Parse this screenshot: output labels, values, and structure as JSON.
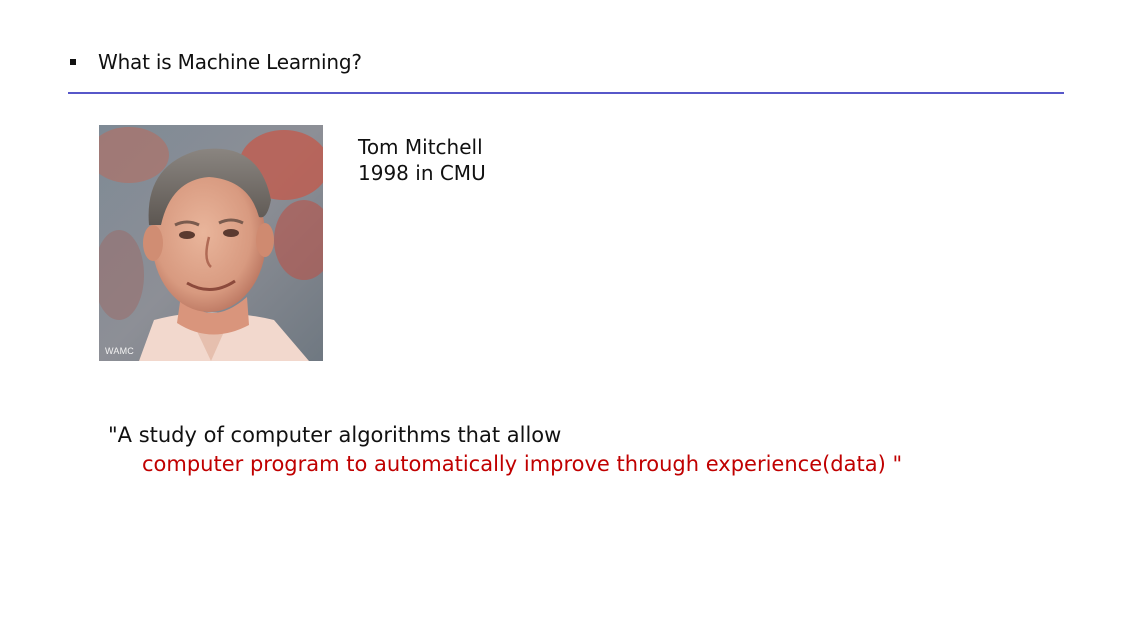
{
  "slide": {
    "title": "What is Machine Learning?",
    "accent_rule_color": "#5757c9",
    "quote_highlight_color": "#c00000"
  },
  "person": {
    "name": "Tom Mitchell",
    "detail": "1998 in CMU",
    "photo_watermark": "WAMC"
  },
  "quote": {
    "line1": "\"A study of computer algorithms that allow",
    "line2": "computer program to automatically improve through experience(data) \""
  }
}
